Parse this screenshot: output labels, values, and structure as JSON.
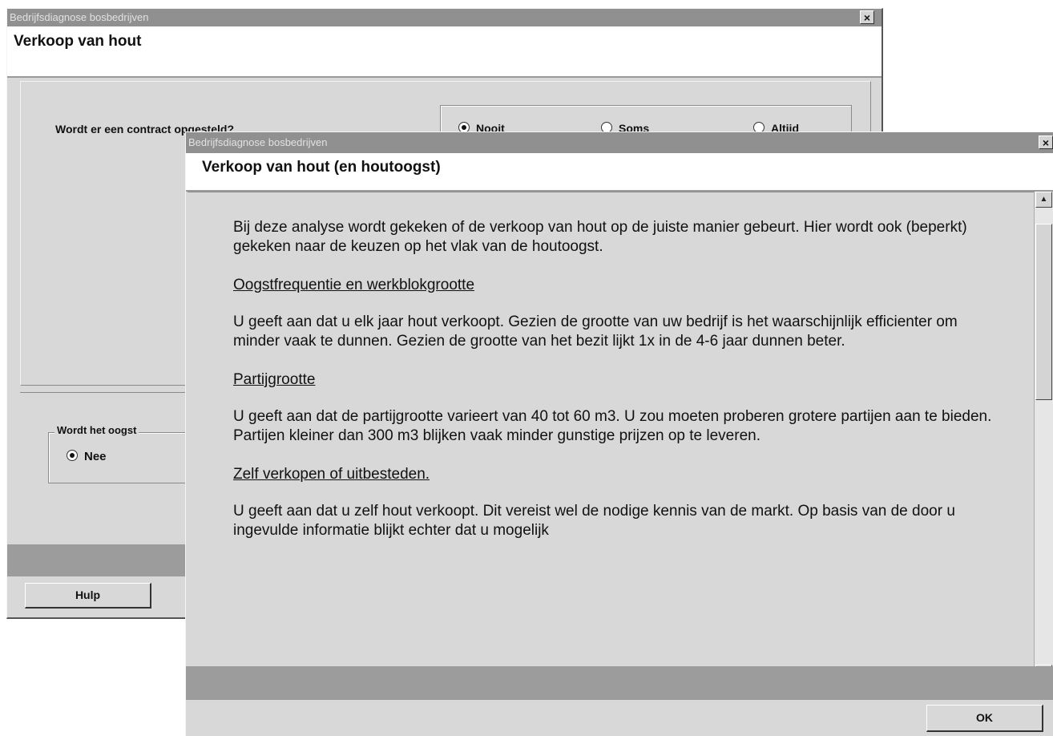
{
  "back_window": {
    "title": "Bedrijfsdiagnose bosbedrijven",
    "close_glyph": "×",
    "header": "Verkoop van hout",
    "question": "Wordt er een contract opgesteld?",
    "options": [
      "Nooit",
      "Soms",
      "Altijd"
    ],
    "oogst_legend": "Wordt het oogst",
    "oogst_selected": "Nee",
    "help_button": "Hulp"
  },
  "front_window": {
    "title": "Bedrijfsdiagnose bosbedrijven",
    "close_glyph": "×",
    "header": "Verkoop van hout (en houtoogst)",
    "intro": "Bij deze analyse wordt gekeken of de verkoop van hout op de juiste manier gebeurt. Hier wordt ook (beperkt) gekeken naar de keuzen op het vlak van de houtoogst.",
    "sections": [
      {
        "heading": "Oogstfrequentie en werkblokgrootte",
        "body": "U geeft aan dat u elk jaar hout verkoopt. Gezien de grootte van uw bedrijf is het waarschijnlijk efficienter om minder vaak te dunnen. Gezien de grootte van het bezit lijkt 1x in de 4-6 jaar dunnen beter."
      },
      {
        "heading": "Partijgrootte",
        "body": "U geeft aan dat de partijgrootte varieert van 40 tot 60 m3. U zou moeten proberen grotere partijen aan te bieden. Partijen kleiner dan 300 m3 blijken vaak minder gunstige prijzen op te leveren."
      },
      {
        "heading": "Zelf verkopen of uitbesteden.",
        "body": "U geeft aan dat u zelf hout verkoopt. Dit vereist wel de nodige kennis van de markt. Op basis van de door u ingevulde informatie blijkt echter dat u mogelijk"
      }
    ],
    "scroll_up_glyph": "▲",
    "scroll_down_glyph": "▼",
    "ok_button": "OK"
  }
}
